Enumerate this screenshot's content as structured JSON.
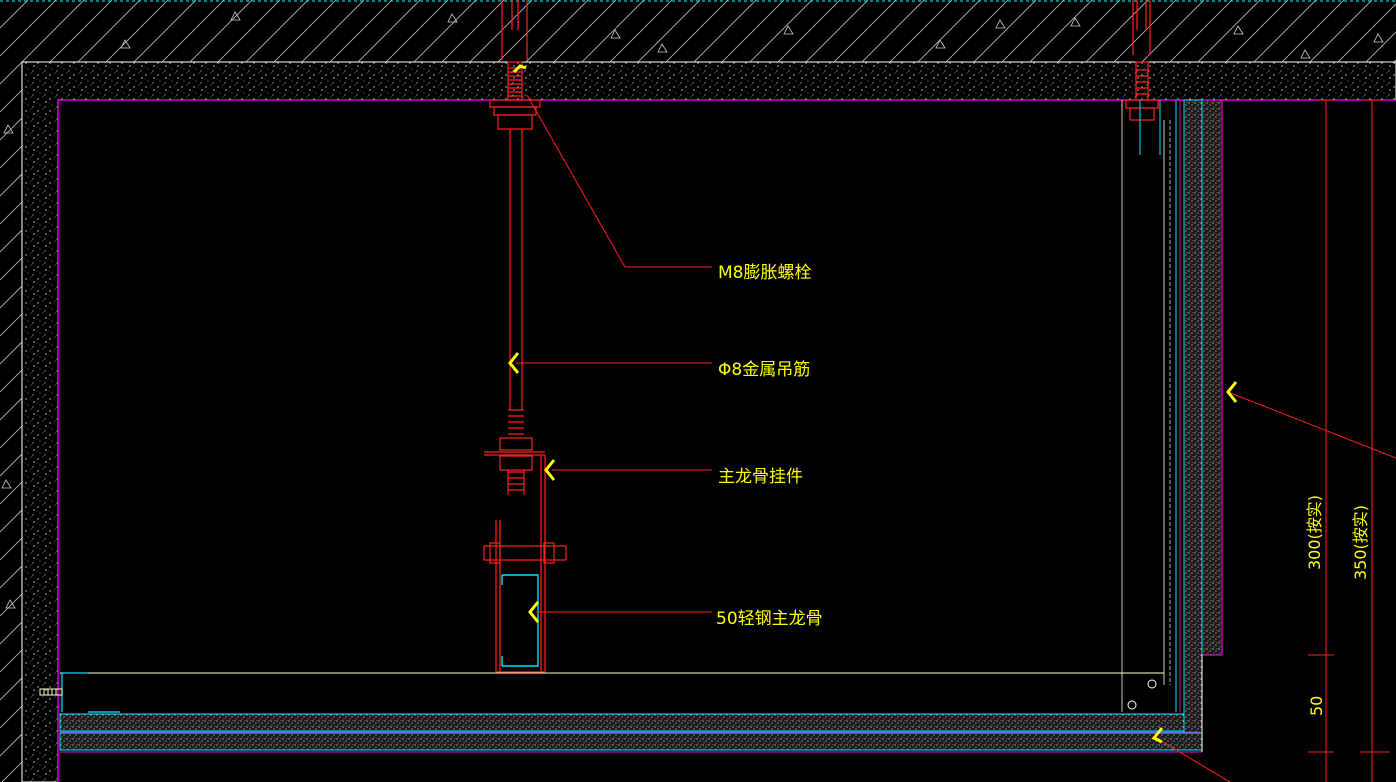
{
  "drawing": {
    "background": "#000000",
    "colors": {
      "concrete_outline": "#ffffff",
      "boundary": "#ff00ff",
      "bolt": "#ff2020",
      "channel": "#00e5ff",
      "leader": "#ff2020",
      "label": "#ffff00",
      "thin_line": "#ffffcc"
    },
    "annotations": [
      {
        "id": "expansion-bolt",
        "text": "M8膨胀螺栓"
      },
      {
        "id": "hanger-rod",
        "text": "Φ8金属吊筋"
      },
      {
        "id": "main-keel-hanger",
        "text": "主龙骨挂件"
      },
      {
        "id": "main-keel",
        "text": "50轻钢主龙骨"
      }
    ],
    "dimensions": [
      {
        "id": "dim-300",
        "text": "300(按实)"
      },
      {
        "id": "dim-350",
        "text": "350(按实)"
      },
      {
        "id": "dim-50",
        "text": "50"
      }
    ]
  }
}
